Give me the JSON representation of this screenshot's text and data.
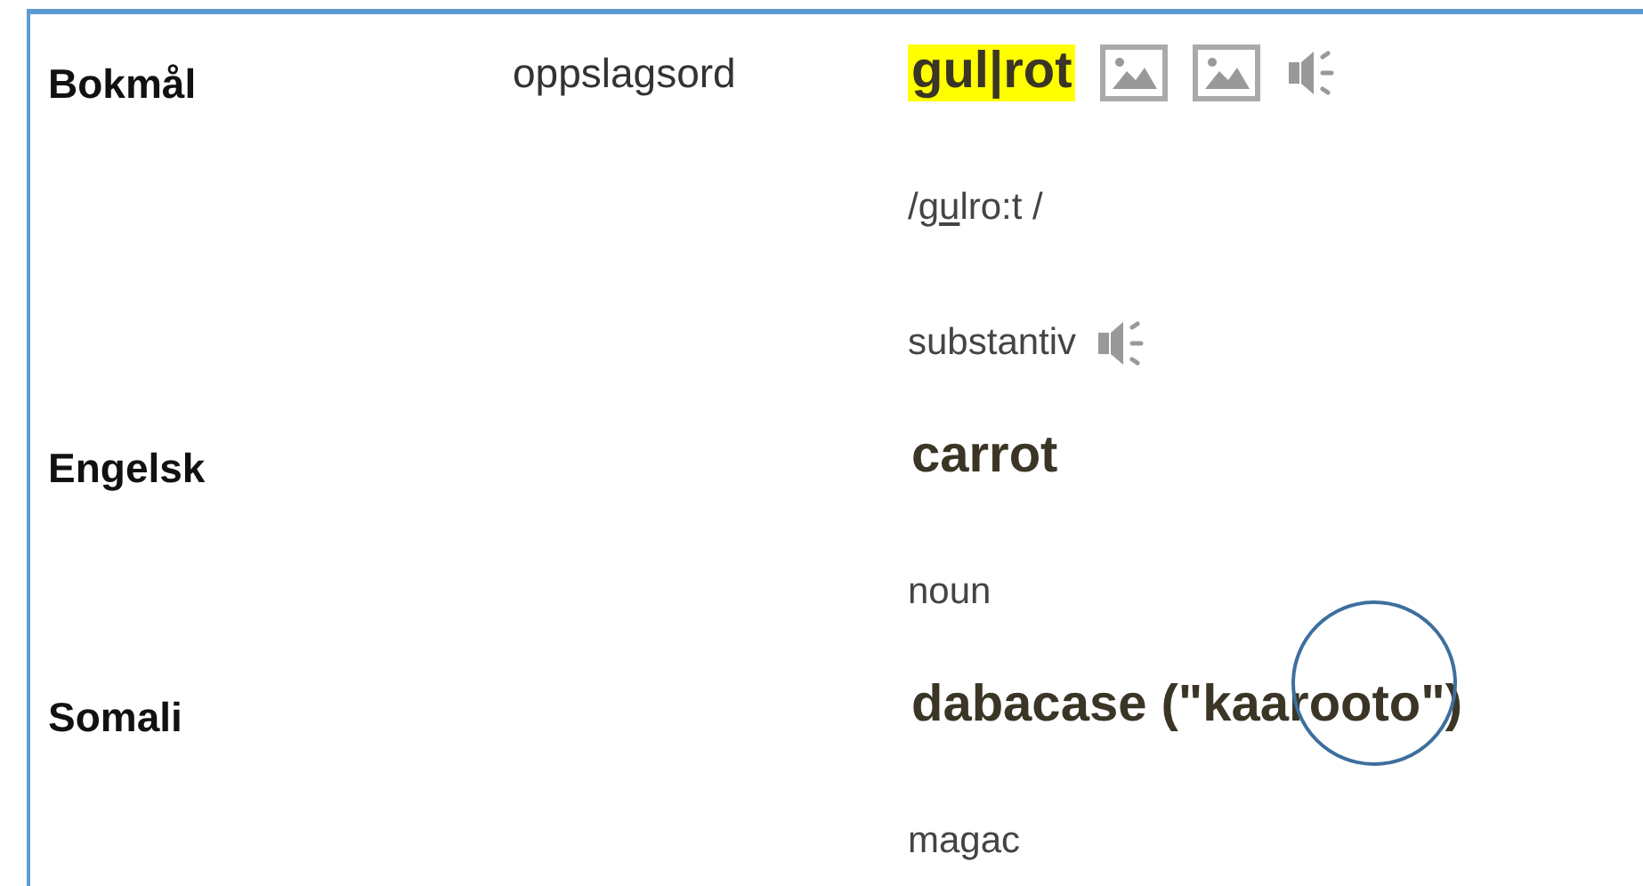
{
  "entries": [
    {
      "language": "Bokmål",
      "label": "oppslagsord",
      "headword": "gul|rot",
      "highlighted": true,
      "icons": [
        {
          "kind": "image"
        },
        {
          "kind": "image"
        },
        {
          "kind": "audio"
        }
      ],
      "details": [
        {
          "kind": "pronunciation",
          "before": "/g",
          "stressed": "u",
          "after": "lro:t /"
        },
        {
          "kind": "word_class",
          "text": "substantiv",
          "audio": true
        }
      ]
    },
    {
      "language": "Engelsk",
      "headword": "carrot",
      "highlighted": false,
      "details": [
        {
          "kind": "word_class",
          "text": "noun",
          "audio": false
        }
      ]
    },
    {
      "language": "Somali",
      "headword": "dabacase (\"kaarooto\")",
      "highlighted": false,
      "details": [
        {
          "kind": "word_class",
          "text": "magac",
          "audio": false
        }
      ]
    }
  ],
  "annotations": [
    {
      "kind": "circle"
    }
  ]
}
